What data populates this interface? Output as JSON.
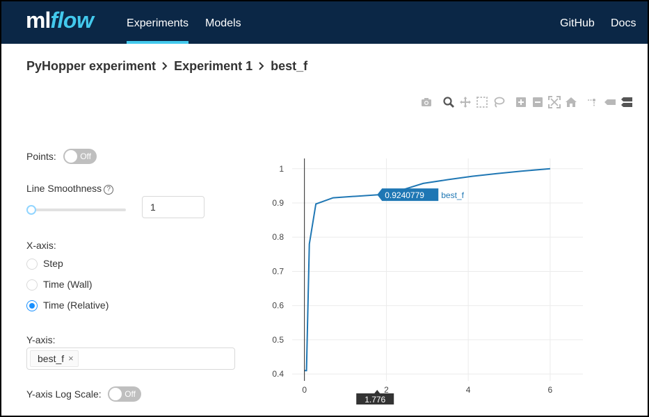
{
  "header": {
    "logo_ml": "ml",
    "logo_flow": "flow",
    "nav": [
      "Experiments",
      "Models"
    ],
    "nav_right": [
      "GitHub",
      "Docs"
    ]
  },
  "breadcrumb": [
    "PyHopper experiment",
    "Experiment 1",
    "best_f"
  ],
  "toolbar_icons": [
    "camera-icon",
    "zoom-icon",
    "pan-icon",
    "box-select-icon",
    "lasso-select-icon",
    "zoom-in-icon",
    "zoom-out-icon",
    "autoscale-icon",
    "reset-axes-icon",
    "spike-lines-icon",
    "hover-closest-icon",
    "hover-compare-icon"
  ],
  "controls": {
    "points_label": "Points:",
    "points_toggle": "Off",
    "smoothing_label": "Line Smoothness",
    "smoothing_help": "?",
    "smoothing_value": "1",
    "smoothing_slider_fraction": 0,
    "xaxis_label": "X-axis:",
    "xaxis_options": [
      "Step",
      "Time (Wall)",
      "Time (Relative)"
    ],
    "xaxis_selected": "Time (Relative)",
    "yaxis_label": "Y-axis:",
    "yaxis_tags": [
      "best_f"
    ],
    "yaxis_tag_close": "×",
    "log_scale_label": "Y-axis Log Scale:",
    "log_scale_toggle": "Off"
  },
  "chart_data": {
    "type": "line",
    "series": [
      {
        "name": "best_f",
        "color": "#1f77b4",
        "x": [
          0,
          0.05,
          0.12,
          0.28,
          0.7,
          1.3,
          1.8,
          2.3,
          2.9,
          3.5,
          4.1,
          4.7,
          5.3,
          6.0
        ],
        "y": [
          0.41,
          0.41,
          0.78,
          0.897,
          0.915,
          0.92,
          0.924,
          0.935,
          0.957,
          0.968,
          0.978,
          0.986,
          0.993,
          1.0
        ]
      }
    ],
    "xlim": [
      -0.3,
      6.8
    ],
    "ylim": [
      0.38,
      1.03
    ],
    "xticks": [
      "0",
      "2",
      "4",
      "6"
    ],
    "yticks": [
      "0.4",
      "0.5",
      "0.6",
      "0.7",
      "0.8",
      "0.9",
      "1"
    ],
    "grid": true,
    "hover": {
      "x": 1.776,
      "x_label": "1.776",
      "y_label": "0.9240779",
      "series_label": "best_f"
    }
  }
}
